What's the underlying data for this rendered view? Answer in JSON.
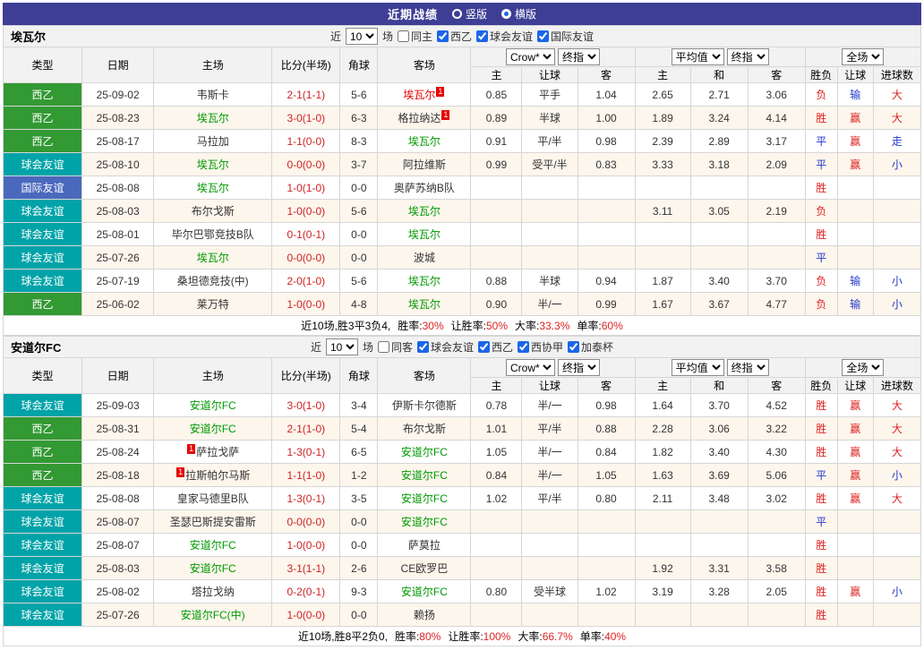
{
  "topbar": {
    "title": "近期战绩",
    "options": [
      {
        "label": "竖版",
        "selected": false
      },
      {
        "label": "横版",
        "selected": true
      }
    ]
  },
  "filters_common": {
    "near": "近",
    "count": "10",
    "matches": "场"
  },
  "table_header": {
    "type": "类型",
    "date": "日期",
    "home": "主场",
    "score": "比分(半场)",
    "corner": "角球",
    "away": "客场",
    "ah_selects": [
      "Crow*",
      "终指"
    ],
    "ah_cols": [
      "主",
      "让球",
      "客"
    ],
    "eu_selects": [
      "平均值",
      "终指"
    ],
    "eu_cols": [
      "主",
      "和",
      "客"
    ],
    "full_select": "全场",
    "result_cols": [
      "胜负",
      "让球",
      "进球数"
    ]
  },
  "colors": {
    "topbar_bg": "#3e3e95",
    "league_xiyi": "#339933",
    "friendly_club": "#00a3a8",
    "friendly_intl": "#4a69bd",
    "focal_team_green": "#009900",
    "highlight_red": "#e60000",
    "score_red": "#cc2222",
    "result_red": "#dd2222",
    "result_blue": "#2336c9",
    "row_alt_bg": "#fdf6ec",
    "header_bg": "#f2f2f2",
    "border": "#d6d6d6",
    "radio_selected_blue": "#1a66e8"
  },
  "sections": [
    {
      "team": "埃瓦尔",
      "filters": [
        {
          "label": "同主",
          "checked": false
        },
        {
          "label": "西乙",
          "checked": true
        },
        {
          "label": "球会友谊",
          "checked": true
        },
        {
          "label": "国际友谊",
          "checked": true
        }
      ],
      "rows": [
        {
          "type": "西乙",
          "date": "25-09-02",
          "home": "韦斯卡",
          "home_class": "",
          "home_badge": "",
          "score": "2-1(1-1)",
          "corner": "5-6",
          "away": "埃瓦尔",
          "away_class": "red",
          "away_badge": "1",
          "ah": [
            "0.85",
            "平手",
            "1.04"
          ],
          "eu": [
            "2.65",
            "2.71",
            "3.06"
          ],
          "res": [
            "负",
            "输",
            "大"
          ]
        },
        {
          "type": "西乙",
          "date": "25-08-23",
          "home": "埃瓦尔",
          "home_class": "green",
          "home_badge": "",
          "score": "3-0(1-0)",
          "corner": "6-3",
          "away": "格拉纳达",
          "away_class": "",
          "away_badge": "1",
          "ah": [
            "0.89",
            "半球",
            "1.00"
          ],
          "eu": [
            "1.89",
            "3.24",
            "4.14"
          ],
          "res": [
            "胜",
            "赢",
            "大"
          ]
        },
        {
          "type": "西乙",
          "date": "25-08-17",
          "home": "马拉加",
          "home_class": "",
          "home_badge": "",
          "score": "1-1(0-0)",
          "corner": "8-3",
          "away": "埃瓦尔",
          "away_class": "green",
          "away_badge": "",
          "ah": [
            "0.91",
            "平/半",
            "0.98"
          ],
          "eu": [
            "2.39",
            "2.89",
            "3.17"
          ],
          "res": [
            "平",
            "赢",
            "走"
          ]
        },
        {
          "type": "球会友谊",
          "date": "25-08-10",
          "home": "埃瓦尔",
          "home_class": "green",
          "home_badge": "",
          "score": "0-0(0-0)",
          "corner": "3-7",
          "away": "阿拉维斯",
          "away_class": "",
          "away_badge": "",
          "ah": [
            "0.99",
            "受平/半",
            "0.83"
          ],
          "eu": [
            "3.33",
            "3.18",
            "2.09"
          ],
          "res": [
            "平",
            "赢",
            "小"
          ]
        },
        {
          "type": "国际友谊",
          "date": "25-08-08",
          "home": "埃瓦尔",
          "home_class": "green",
          "home_badge": "",
          "score": "1-0(1-0)",
          "corner": "0-0",
          "away": "奥萨苏纳B队",
          "away_class": "",
          "away_badge": "",
          "ah": [
            "",
            "",
            ""
          ],
          "eu": [
            "",
            "",
            ""
          ],
          "res": [
            "胜",
            "",
            ""
          ]
        },
        {
          "type": "球会友谊",
          "date": "25-08-03",
          "home": "布尔戈斯",
          "home_class": "",
          "home_badge": "",
          "score": "1-0(0-0)",
          "corner": "5-6",
          "away": "埃瓦尔",
          "away_class": "green",
          "away_badge": "",
          "ah": [
            "",
            "",
            ""
          ],
          "eu": [
            "3.11",
            "3.05",
            "2.19"
          ],
          "res": [
            "负",
            "",
            ""
          ]
        },
        {
          "type": "球会友谊",
          "date": "25-08-01",
          "home": "毕尔巴鄂竞技B队",
          "home_class": "",
          "home_badge": "",
          "score": "0-1(0-1)",
          "corner": "0-0",
          "away": "埃瓦尔",
          "away_class": "green",
          "away_badge": "",
          "ah": [
            "",
            "",
            ""
          ],
          "eu": [
            "",
            "",
            ""
          ],
          "res": [
            "胜",
            "",
            ""
          ]
        },
        {
          "type": "球会友谊",
          "date": "25-07-26",
          "home": "埃瓦尔",
          "home_class": "green",
          "home_badge": "",
          "score": "0-0(0-0)",
          "corner": "0-0",
          "away": "波城",
          "away_class": "",
          "away_badge": "",
          "ah": [
            "",
            "",
            ""
          ],
          "eu": [
            "",
            "",
            ""
          ],
          "res": [
            "平",
            "",
            ""
          ]
        },
        {
          "type": "球会友谊",
          "date": "25-07-19",
          "home": "桑坦德竞技(中)",
          "home_class": "",
          "home_badge": "",
          "score": "2-0(1-0)",
          "corner": "5-6",
          "away": "埃瓦尔",
          "away_class": "green",
          "away_badge": "",
          "ah": [
            "0.88",
            "半球",
            "0.94"
          ],
          "eu": [
            "1.87",
            "3.40",
            "3.70"
          ],
          "res": [
            "负",
            "输",
            "小"
          ]
        },
        {
          "type": "西乙",
          "date": "25-06-02",
          "home": "莱万特",
          "home_class": "",
          "home_badge": "",
          "score": "1-0(0-0)",
          "corner": "4-8",
          "away": "埃瓦尔",
          "away_class": "green",
          "away_badge": "",
          "ah": [
            "0.90",
            "半/一",
            "0.99"
          ],
          "eu": [
            "1.67",
            "3.67",
            "4.77"
          ],
          "res": [
            "负",
            "输",
            "小"
          ]
        }
      ],
      "summary": {
        "prefix": "近10场,胜3平3负4,",
        "stats": [
          {
            "label": "胜率:",
            "value": "30%"
          },
          {
            "label": "让胜率:",
            "value": "50%"
          },
          {
            "label": "大率:",
            "value": "33.3%"
          },
          {
            "label": "单率:",
            "value": "60%"
          }
        ]
      }
    },
    {
      "team": "安道尔FC",
      "filters": [
        {
          "label": "同客",
          "checked": false
        },
        {
          "label": "球会友谊",
          "checked": true
        },
        {
          "label": "西乙",
          "checked": true
        },
        {
          "label": "西协甲",
          "checked": true
        },
        {
          "label": "加泰杯",
          "checked": true
        }
      ],
      "rows": [
        {
          "type": "球会友谊",
          "date": "25-09-03",
          "home": "安道尔FC",
          "home_class": "green",
          "home_badge": "",
          "score": "3-0(1-0)",
          "corner": "3-4",
          "away": "伊斯卡尔德斯",
          "away_class": "",
          "away_badge": "",
          "ah": [
            "0.78",
            "半/一",
            "0.98"
          ],
          "eu": [
            "1.64",
            "3.70",
            "4.52"
          ],
          "res": [
            "胜",
            "赢",
            "大"
          ]
        },
        {
          "type": "西乙",
          "date": "25-08-31",
          "home": "安道尔FC",
          "home_class": "green",
          "home_badge": "",
          "score": "2-1(1-0)",
          "corner": "5-4",
          "away": "布尔戈斯",
          "away_class": "",
          "away_badge": "",
          "ah": [
            "1.01",
            "平/半",
            "0.88"
          ],
          "eu": [
            "2.28",
            "3.06",
            "3.22"
          ],
          "res": [
            "胜",
            "赢",
            "大"
          ]
        },
        {
          "type": "西乙",
          "date": "25-08-24",
          "home": "萨拉戈萨",
          "home_class": "",
          "home_badge": "1",
          "score": "1-3(0-1)",
          "corner": "6-5",
          "away": "安道尔FC",
          "away_class": "green",
          "away_badge": "",
          "ah": [
            "1.05",
            "半/一",
            "0.84"
          ],
          "eu": [
            "1.82",
            "3.40",
            "4.30"
          ],
          "res": [
            "胜",
            "赢",
            "大"
          ]
        },
        {
          "type": "西乙",
          "date": "25-08-18",
          "home": "拉斯帕尔马斯",
          "home_class": "",
          "home_badge": "1",
          "score": "1-1(1-0)",
          "corner": "1-2",
          "away": "安道尔FC",
          "away_class": "green",
          "away_badge": "",
          "ah": [
            "0.84",
            "半/一",
            "1.05"
          ],
          "eu": [
            "1.63",
            "3.69",
            "5.06"
          ],
          "res": [
            "平",
            "赢",
            "小"
          ]
        },
        {
          "type": "球会友谊",
          "date": "25-08-08",
          "home": "皇家马德里B队",
          "home_class": "",
          "home_badge": "",
          "score": "1-3(0-1)",
          "corner": "3-5",
          "away": "安道尔FC",
          "away_class": "green",
          "away_badge": "",
          "ah": [
            "1.02",
            "平/半",
            "0.80"
          ],
          "eu": [
            "2.11",
            "3.48",
            "3.02"
          ],
          "res": [
            "胜",
            "赢",
            "大"
          ]
        },
        {
          "type": "球会友谊",
          "date": "25-08-07",
          "home": "圣瑟巴斯提安雷斯",
          "home_class": "",
          "home_badge": "",
          "score": "0-0(0-0)",
          "corner": "0-0",
          "away": "安道尔FC",
          "away_class": "green",
          "away_badge": "",
          "ah": [
            "",
            "",
            ""
          ],
          "eu": [
            "",
            "",
            ""
          ],
          "res": [
            "平",
            "",
            ""
          ]
        },
        {
          "type": "球会友谊",
          "date": "25-08-07",
          "home": "安道尔FC",
          "home_class": "green",
          "home_badge": "",
          "score": "1-0(0-0)",
          "corner": "0-0",
          "away": "萨莫拉",
          "away_class": "",
          "away_badge": "",
          "ah": [
            "",
            "",
            ""
          ],
          "eu": [
            "",
            "",
            ""
          ],
          "res": [
            "胜",
            "",
            ""
          ]
        },
        {
          "type": "球会友谊",
          "date": "25-08-03",
          "home": "安道尔FC",
          "home_class": "green",
          "home_badge": "",
          "score": "3-1(1-1)",
          "corner": "2-6",
          "away": "CE欧罗巴",
          "away_class": "",
          "away_badge": "",
          "ah": [
            "",
            "",
            ""
          ],
          "eu": [
            "1.92",
            "3.31",
            "3.58"
          ],
          "res": [
            "胜",
            "",
            ""
          ]
        },
        {
          "type": "球会友谊",
          "date": "25-08-02",
          "home": "塔拉戈纳",
          "home_class": "",
          "home_badge": "",
          "score": "0-2(0-1)",
          "corner": "9-3",
          "away": "安道尔FC",
          "away_class": "green",
          "away_badge": "",
          "ah": [
            "0.80",
            "受半球",
            "1.02"
          ],
          "eu": [
            "3.19",
            "3.28",
            "2.05"
          ],
          "res": [
            "胜",
            "赢",
            "小"
          ]
        },
        {
          "type": "球会友谊",
          "date": "25-07-26",
          "home": "安道尔FC(中)",
          "home_class": "green",
          "home_badge": "",
          "score": "1-0(0-0)",
          "corner": "0-0",
          "away": "赖扬",
          "away_class": "",
          "away_badge": "",
          "ah": [
            "",
            "",
            ""
          ],
          "eu": [
            "",
            "",
            ""
          ],
          "res": [
            "胜",
            "",
            ""
          ]
        }
      ],
      "summary": {
        "prefix": "近10场,胜8平2负0,",
        "stats": [
          {
            "label": "胜率:",
            "value": "80%"
          },
          {
            "label": "让胜率:",
            "value": "100%"
          },
          {
            "label": "大率:",
            "value": "66.7%"
          },
          {
            "label": "单率:",
            "value": "40%"
          }
        ]
      }
    }
  ]
}
